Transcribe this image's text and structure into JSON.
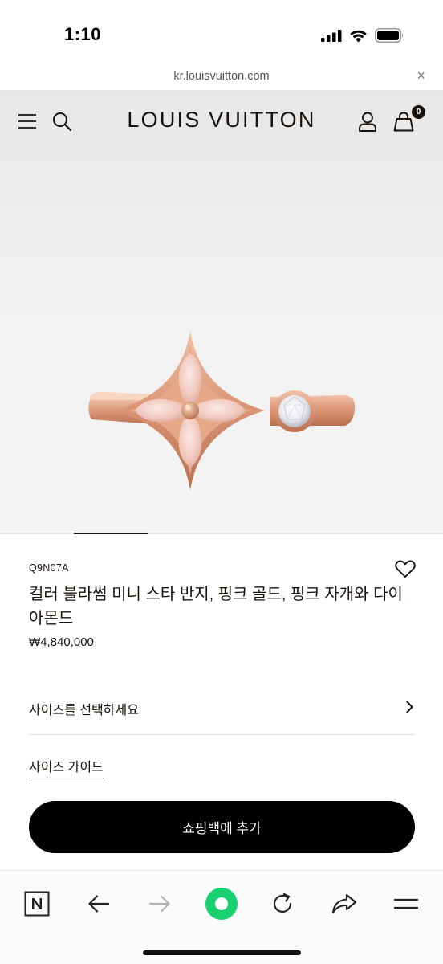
{
  "status_bar": {
    "time": "1:10"
  },
  "browser": {
    "url": "kr.louisvuitton.com",
    "close_symbol": "×"
  },
  "header": {
    "brand": "LOUIS VUITTON",
    "cart_count": "0"
  },
  "carousel": {
    "active_index": 1
  },
  "product": {
    "sku": "Q9N07A",
    "name": "컬러 블라썸 미니 스타 반지, 핑크 골드, 핑크 자개와 다이아몬드",
    "price": "₩4,840,000",
    "size_select_label": "사이즈를 선택하세요",
    "size_guide_label": "사이즈 가이드",
    "add_to_bag_label": "쇼핑백에 추가"
  },
  "colors": {
    "brand_dark": "#19110b",
    "accent_green": "#19d16e",
    "rose_gold": "#e0a080",
    "pink_mother_of_pearl": "#f2cfc6"
  },
  "icons": {
    "header": [
      "menu-icon",
      "search-icon",
      "account-icon",
      "shopping-bag-icon"
    ],
    "toolbar": [
      "naver-n-icon",
      "back-arrow-icon",
      "forward-arrow-icon",
      "green-dot-icon",
      "reload-icon",
      "share-icon",
      "hamburger-icon"
    ]
  }
}
